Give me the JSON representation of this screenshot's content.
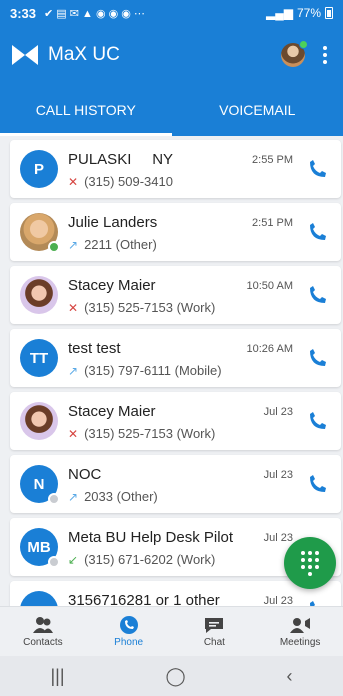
{
  "status_bar": {
    "time": "3:33",
    "battery": "77%",
    "signal": "VoLTE"
  },
  "app_bar": {
    "title": "MaX UC"
  },
  "tabs": [
    {
      "label": "CALL HISTORY",
      "active": true
    },
    {
      "label": "VOICEMAIL",
      "active": false
    }
  ],
  "calls": [
    {
      "name": "PULASKI     NY",
      "detail": "(315) 509-3410",
      "time": "2:55 PM",
      "avatar_text": "P",
      "avatar_type": "initials",
      "direction": "missed",
      "presence": ""
    },
    {
      "name": "Julie Landers",
      "detail": "2211 (Other)",
      "time": "2:51 PM",
      "avatar_text": "",
      "avatar_type": "photo-julie",
      "direction": "outgoing",
      "presence": "online"
    },
    {
      "name": "Stacey Maier",
      "detail": "(315) 525-7153 (Work)",
      "time": "10:50 AM",
      "avatar_text": "",
      "avatar_type": "photo-stacey",
      "direction": "missed",
      "presence": ""
    },
    {
      "name": "test test",
      "detail": "(315) 797-6111 (Mobile)",
      "time": "10:26 AM",
      "avatar_text": "TT",
      "avatar_type": "initials",
      "direction": "outgoing",
      "presence": ""
    },
    {
      "name": "Stacey Maier",
      "detail": "(315) 525-7153 (Work)",
      "time": "Jul 23",
      "avatar_text": "",
      "avatar_type": "photo-stacey",
      "direction": "missed",
      "presence": ""
    },
    {
      "name": "NOC",
      "detail": "2033 (Other)",
      "time": "Jul 23",
      "avatar_text": "N",
      "avatar_type": "initials",
      "direction": "outgoing",
      "presence": "offline"
    },
    {
      "name": "Meta BU Help Desk Pilot",
      "detail": "(315) 671-6202 (Work)",
      "time": "Jul 23",
      "avatar_text": "MB",
      "avatar_type": "initials",
      "direction": "incoming",
      "presence": "offline"
    },
    {
      "name": "3156716281 or 1 other",
      "detail": "",
      "time": "Jul 23",
      "avatar_text": "",
      "avatar_type": "initials",
      "direction": "",
      "presence": ""
    }
  ],
  "bottom_nav": [
    {
      "label": "Contacts",
      "icon": "contacts-icon",
      "active": false
    },
    {
      "label": "Phone",
      "icon": "phone-icon",
      "active": true
    },
    {
      "label": "Chat",
      "icon": "chat-icon",
      "active": false
    },
    {
      "label": "Meetings",
      "icon": "meetings-icon",
      "active": false
    }
  ],
  "colors": {
    "primary": "#1a7fd6",
    "fab": "#1f9b4a",
    "missed": "#d64541",
    "online": "#4caf50"
  }
}
